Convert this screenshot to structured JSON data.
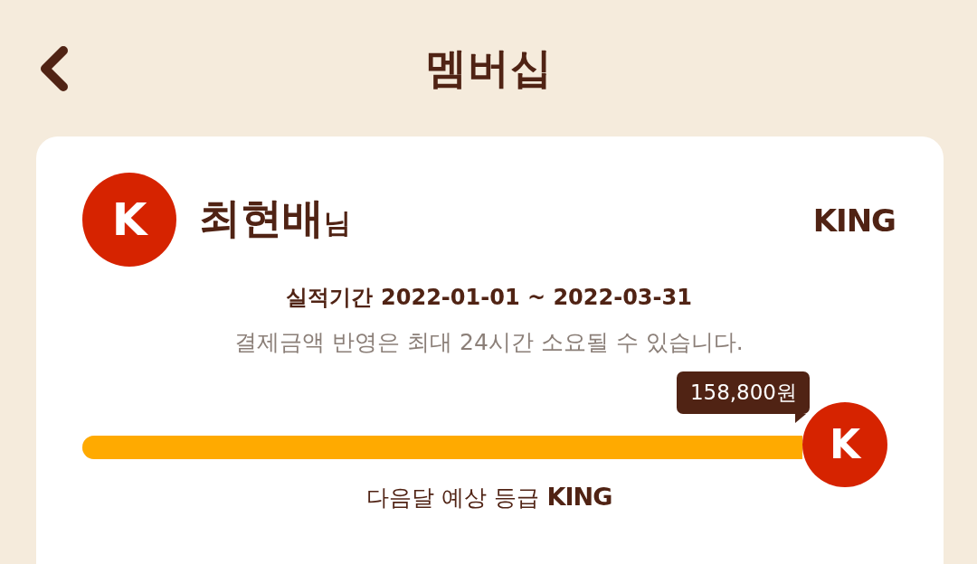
{
  "header": {
    "title": "멤버십"
  },
  "member": {
    "badge_letter": "K",
    "name": "최현배",
    "honorific": "님",
    "grade": "KING"
  },
  "period": {
    "label": "실적기간",
    "range": "2022-01-01 ~ 2022-03-31"
  },
  "notice": "결제금액 반영은 최대 24시간 소요될 수 있습니다.",
  "progress": {
    "amount": "158,800원",
    "level": 1,
    "thumb_letter": "K"
  },
  "next_grade": {
    "label": "다음달 예상 등급",
    "grade": "KING"
  }
}
